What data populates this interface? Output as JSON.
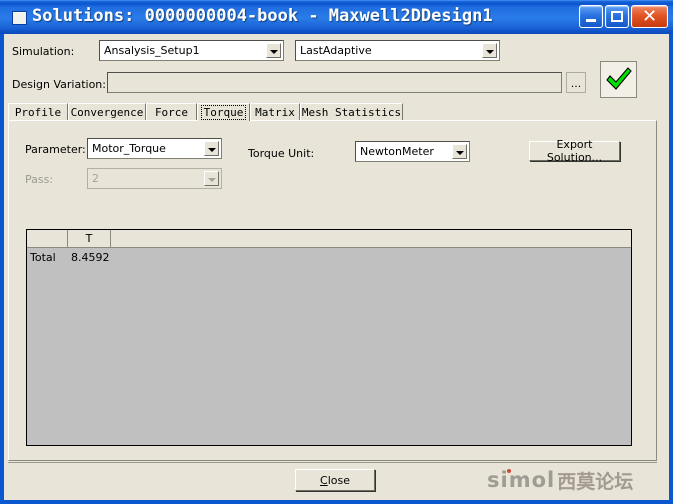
{
  "window": {
    "title": "Solutions: 0000000004-book - Maxwell2DDesign1",
    "icon": "window-icon",
    "buttons": {
      "minimize": "minimize",
      "maximize": "maximize",
      "close": "close"
    }
  },
  "form": {
    "simulation_label": "Simulation:",
    "setup_value": "Ansalysis_Setup1",
    "adaptive_value": "LastAdaptive",
    "design_variation_label": "Design Variation:",
    "design_variation_value": "",
    "browse_label": "...",
    "validate_label": "validate-check"
  },
  "tabs": [
    {
      "label": "Profile",
      "selected": false
    },
    {
      "label": "Convergence",
      "selected": false
    },
    {
      "label": "Force",
      "selected": false
    },
    {
      "label": "Torque",
      "selected": true
    },
    {
      "label": "Matrix",
      "selected": false
    },
    {
      "label": "Mesh Statistics",
      "selected": false
    }
  ],
  "torque_panel": {
    "parameter_label": "Parameter:",
    "parameter_value": "Motor_Torque",
    "torque_unit_label": "Torque Unit:",
    "torque_unit_value": "NewtonMeter",
    "pass_label": "Pass:",
    "pass_value": "2",
    "pass_disabled": true,
    "export_label": "Export Solution..."
  },
  "table": {
    "headers": [
      "",
      "T",
      ""
    ],
    "rows": [
      [
        "Total",
        "8.4592",
        ""
      ]
    ]
  },
  "footer": {
    "close_label": "Close",
    "close_mnemonic": "C",
    "close_rest": "lose",
    "watermark_latin": "simol",
    "watermark_cn": "西莫论坛"
  },
  "colors": {
    "titlebar": "#1565d8",
    "dialog_bg": "#e8e5d8",
    "grid_bg": "#c0c0c0",
    "accent_green": "#00e000",
    "close_red": "#e25524"
  }
}
